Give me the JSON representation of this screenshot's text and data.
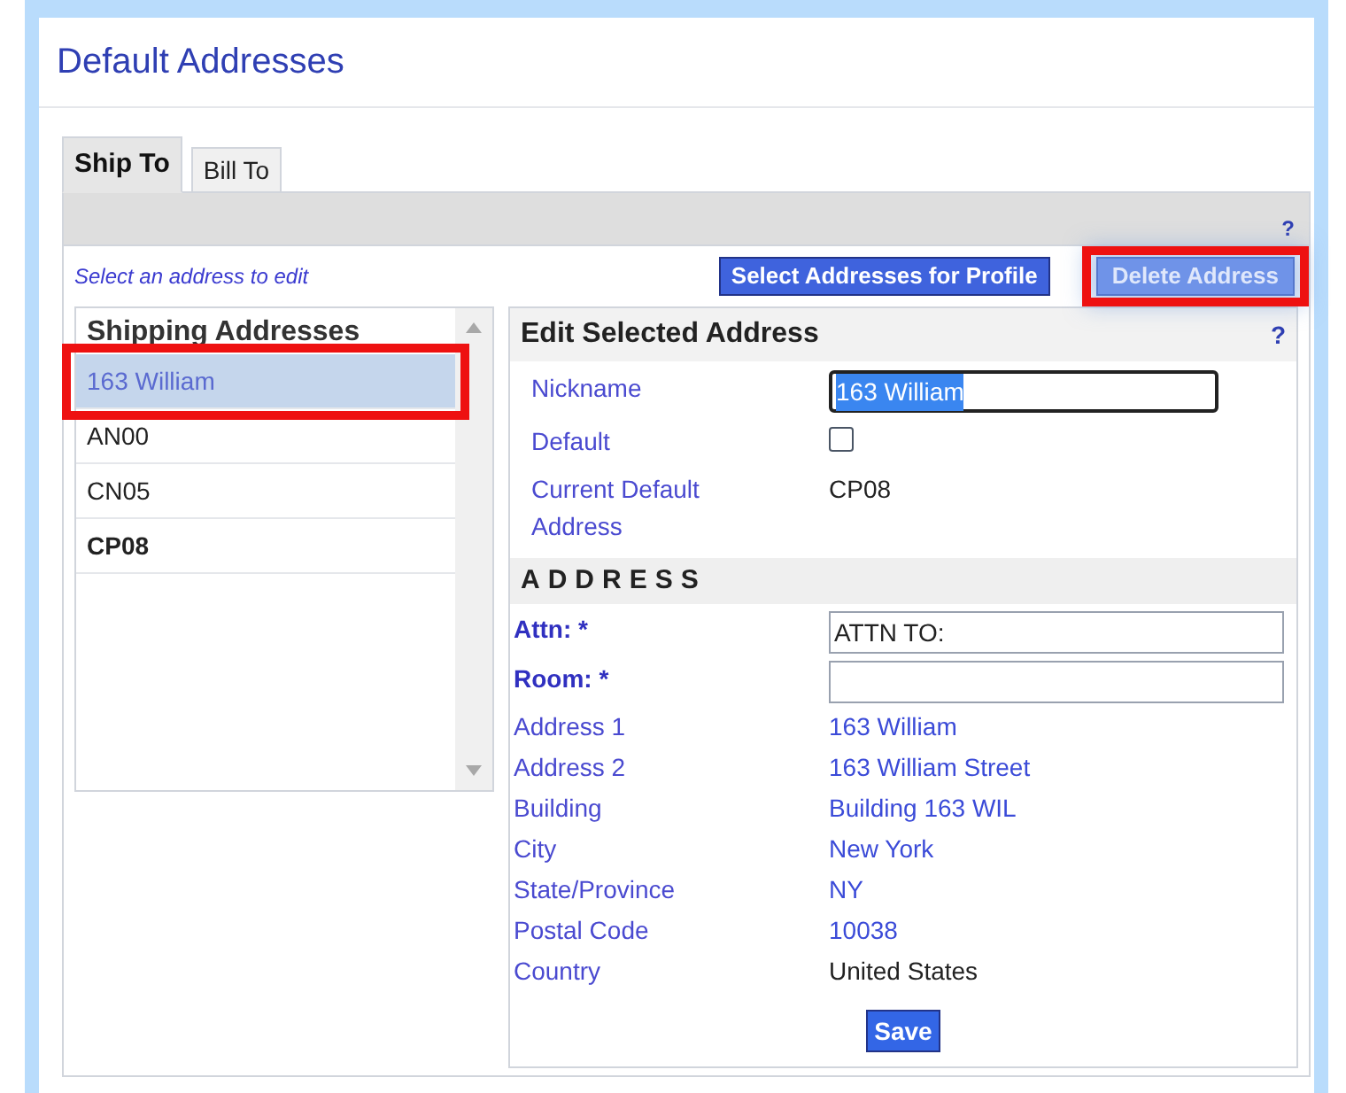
{
  "title": "Default Addresses",
  "tabs": [
    {
      "label": "Ship To",
      "selected": true
    },
    {
      "label": "Bill To",
      "selected": false
    }
  ],
  "help_mark": "?",
  "instruction": "Select an address to edit",
  "buttons": [
    {
      "label": "Select Addresses for Profile",
      "highlighted": false
    },
    {
      "label": "Delete Address",
      "highlighted": true
    }
  ],
  "address_list": {
    "heading": "Shipping Addresses",
    "items": [
      {
        "label": "163 William",
        "selected": true,
        "is_default": false,
        "highlighted": true
      },
      {
        "label": "AN00",
        "selected": false,
        "is_default": false,
        "highlighted": false
      },
      {
        "label": "CN05",
        "selected": false,
        "is_default": false,
        "highlighted": false
      },
      {
        "label": "CP08",
        "selected": false,
        "is_default": true,
        "highlighted": false
      }
    ]
  },
  "editor": {
    "heading": "Edit Selected Address",
    "help_mark": "?",
    "top_fields": [
      {
        "kind": "input",
        "label": "Nickname",
        "value": "163 William",
        "focused": true
      },
      {
        "kind": "checkbox",
        "label": "Default",
        "checked": false
      },
      {
        "kind": "text",
        "label": "Current Default Address",
        "value": "CP08"
      }
    ],
    "section": "ADDRESS",
    "address_fields": [
      {
        "kind": "input",
        "label": "Attn: *",
        "value": "ATTN TO:"
      },
      {
        "kind": "input",
        "label": "Room: *"
      },
      {
        "kind": "link",
        "label": "Address 1",
        "value": "163 William"
      },
      {
        "kind": "link",
        "label": "Address 2",
        "value": "163 William Street"
      },
      {
        "kind": "link",
        "label": "Building",
        "value": "Building 163 WIL"
      },
      {
        "kind": "link",
        "label": "City",
        "value": "New York"
      },
      {
        "kind": "link",
        "label": "State/Province",
        "value": "NY"
      },
      {
        "kind": "link",
        "label": "Postal Code",
        "value": "10038"
      },
      {
        "kind": "text",
        "label": "Country",
        "value": "United States"
      }
    ],
    "save": "Save"
  }
}
